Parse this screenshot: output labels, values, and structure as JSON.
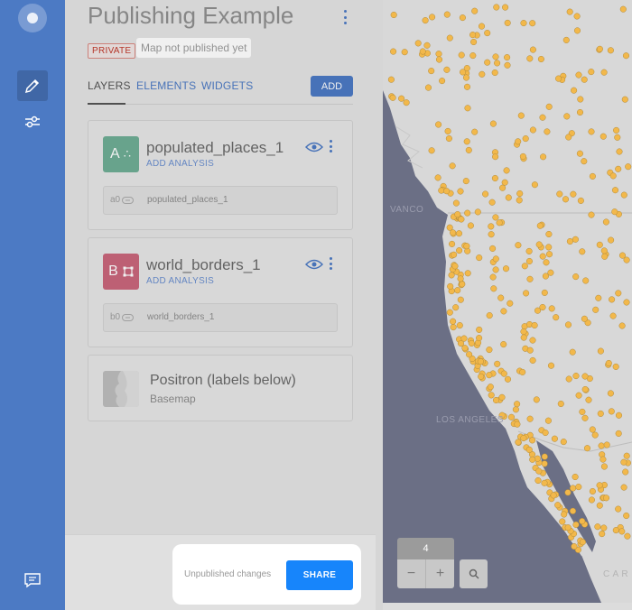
{
  "app": {
    "title": "Publishing Example",
    "privacy_badge": "PRIVATE",
    "publish_status_tag": "Map not published yet"
  },
  "rail": {
    "items": [
      {
        "icon": "pencil-icon",
        "active": true
      },
      {
        "icon": "sliders-icon",
        "active": false
      }
    ],
    "footer_icon": "feedback-icon"
  },
  "tabs": [
    {
      "label": "LAYERS",
      "active": true
    },
    {
      "label": "ELEMENTS",
      "active": false
    },
    {
      "label": "WIDGETS",
      "active": false
    }
  ],
  "add_button": "ADD",
  "layers": [
    {
      "letter": "A",
      "name": "populated_places_1",
      "action": "ADD ANALYSIS",
      "source_id": "a0",
      "source_name": "populated_places_1",
      "color": "#6fae95"
    },
    {
      "letter": "B",
      "name": "world_borders_1",
      "action": "ADD ANALYSIS",
      "source_id": "b0",
      "source_name": "world_borders_1",
      "color": "#c9677c"
    }
  ],
  "basemap": {
    "name": "Positron (labels below)",
    "type": "Basemap"
  },
  "footer": {
    "status": "Unpublished changes",
    "share_button": "SHARE"
  },
  "map": {
    "labels": [
      "VANCO",
      "LOS ANGELES",
      "C A R"
    ],
    "zoom_level": "4",
    "zoom_out": "−",
    "zoom_in": "+",
    "colors": {
      "water": "#6b6f85",
      "land": "#d8d8d8",
      "points": "#f2b84b",
      "accent": "#4c7ac4",
      "share": "#1785fb"
    }
  }
}
